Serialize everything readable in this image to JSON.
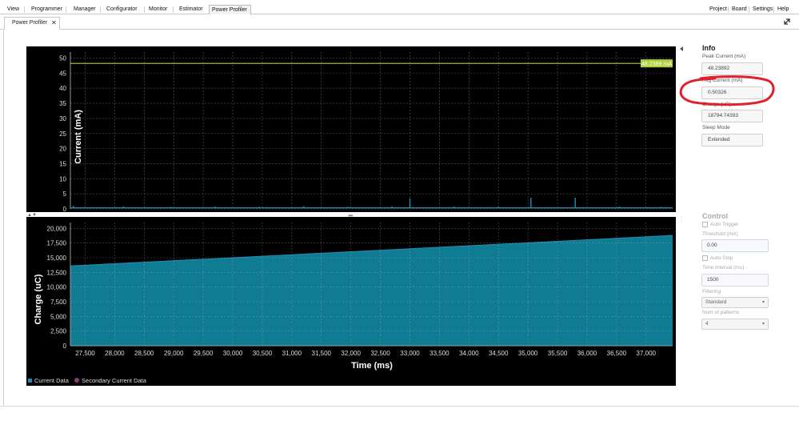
{
  "menu": {
    "items": [
      "View",
      "Programmer",
      "Manager",
      "Configurator",
      "Monitor",
      "Estimator",
      "Power Profiler"
    ],
    "right_items": [
      "Project",
      "Board",
      "Settings",
      "Help"
    ],
    "active": "Power Profiler"
  },
  "tab": {
    "label": "Power Profiler",
    "close": "✕"
  },
  "info": {
    "title": "Info",
    "peak_label": "Peak Current (mA)",
    "peak_value": "48.23892",
    "avg_label": "Avg Current (mA)",
    "avg_value": "0.50326",
    "charge_label": "Charge (uC)",
    "charge_value": "18794.74393",
    "sleep_label": "Sleep Mode",
    "sleep_value": "Extended"
  },
  "control": {
    "title": "Control",
    "auto_trigger": "Auto Trigger",
    "threshold_label": "Threshold (mA)",
    "threshold_value": "0.00",
    "auto_stop": "Auto Stop",
    "interval_label": "Time Interval (ms)",
    "interval_value": "1500",
    "filtering_label": "Filtering",
    "filtering_value": "Standard",
    "patterns_label": "Num of patterns",
    "patterns_value": "4"
  },
  "legend": {
    "current": "Current Data",
    "secondary": "Secondary Current Data"
  },
  "colors": {
    "series": "#1c8fb3",
    "area": "#0f7c93",
    "peak_line": "#b0d040",
    "secondary": "#8a3a78",
    "annotation": "#e0202a"
  },
  "chart_data": [
    {
      "type": "line",
      "ylabel": "Current (mA)",
      "xlim": [
        27250,
        37450
      ],
      "ylim": [
        0,
        52
      ],
      "yticks": [
        0,
        5,
        10,
        15,
        20,
        25,
        30,
        35,
        40,
        45,
        50
      ],
      "grid": true,
      "peak_marker": {
        "value": 48.2389,
        "label": "48.2389 mA"
      },
      "baseline": 0.35,
      "spikes": [
        {
          "x": 27300,
          "y": 1.0
        },
        {
          "x": 28150,
          "y": 0.8
        },
        {
          "x": 28950,
          "y": 0.7
        },
        {
          "x": 29700,
          "y": 0.8
        },
        {
          "x": 30450,
          "y": 0.7
        },
        {
          "x": 31200,
          "y": 0.9
        },
        {
          "x": 31950,
          "y": 0.7
        },
        {
          "x": 32700,
          "y": 0.8
        },
        {
          "x": 33000,
          "y": 3.5
        },
        {
          "x": 33750,
          "y": 0.8
        },
        {
          "x": 34500,
          "y": 0.7
        },
        {
          "x": 35050,
          "y": 3.7
        },
        {
          "x": 35800,
          "y": 3.7
        },
        {
          "x": 36550,
          "y": 0.8
        },
        {
          "x": 37250,
          "y": 0.7
        }
      ]
    },
    {
      "type": "area",
      "xlabel": "Time (ms)",
      "ylabel": "Charge (uC)",
      "xlim": [
        27250,
        37450
      ],
      "ylim": [
        0,
        21000
      ],
      "yticks": [
        0,
        2500,
        5000,
        7500,
        10000,
        12500,
        15000,
        17500,
        20000
      ],
      "ytick_labels": [
        "0",
        "2,500",
        "5,000",
        "7,500",
        "10,000",
        "12,500",
        "15,000",
        "17,500",
        "20,000"
      ],
      "xticks": [
        27500,
        28000,
        28500,
        29000,
        29500,
        30000,
        30500,
        31000,
        31500,
        32000,
        32500,
        33000,
        33500,
        34000,
        34500,
        35000,
        35500,
        36000,
        36500,
        37000
      ],
      "xtick_labels": [
        "27,500",
        "28,000",
        "28,500",
        "29,000",
        "29,500",
        "30,000",
        "30,500",
        "31,000",
        "31,500",
        "32,000",
        "32,500",
        "33,000",
        "33,500",
        "34,000",
        "34,500",
        "35,000",
        "35,500",
        "36,000",
        "36,500",
        "37,000"
      ],
      "grid": true,
      "series": [
        {
          "name": "Current Data",
          "x": [
            27250,
            37450
          ],
          "values": [
            13600,
            18800
          ]
        }
      ]
    }
  ]
}
